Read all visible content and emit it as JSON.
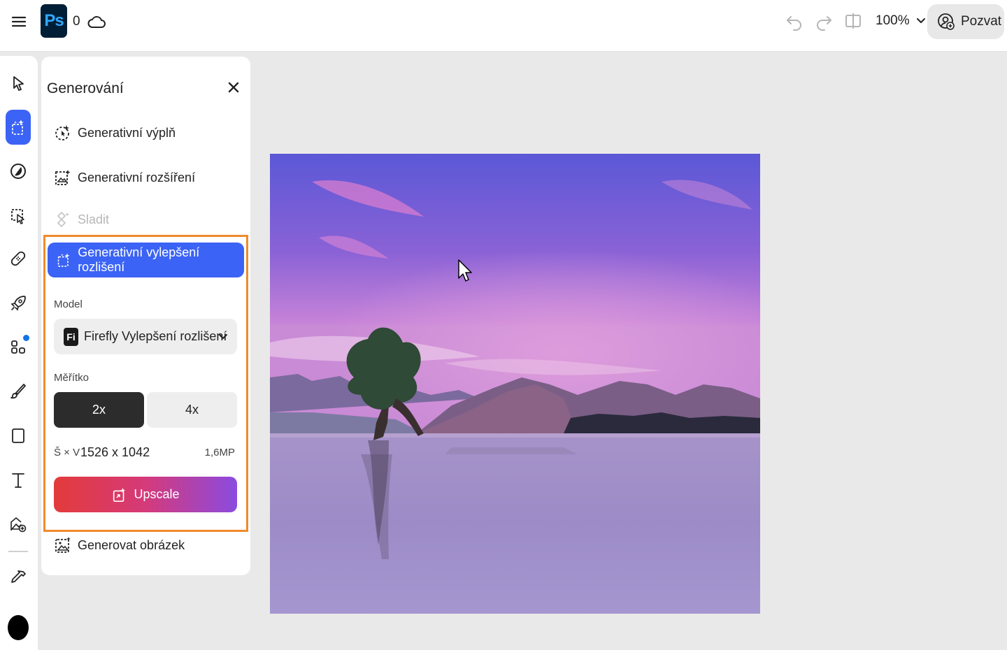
{
  "topbar": {
    "app_logo": "Ps",
    "cloud_count": "0",
    "zoom_label": "100%",
    "invite_label": "Pozvat"
  },
  "panel": {
    "title": "Generování",
    "items": [
      {
        "label": "Generativní výplň",
        "disabled": false
      },
      {
        "label": "Generativní rozšíření",
        "disabled": false
      },
      {
        "label": "Sladit",
        "disabled": true
      }
    ],
    "active_item": "Generativní vylepšení rozlišení",
    "model_label": "Model",
    "model_logo": "Fi",
    "model_value": "Firefly Vylepšení rozlišení",
    "scale_label": "Měřítko",
    "scale_options": [
      "2x",
      "4x"
    ],
    "scale_selected": "2x",
    "dims_label": "Š × V",
    "dims_value": "1526 x 1042",
    "megapixels": "1,6MP",
    "upscale_button": "Upscale",
    "generate_image": "Generovat obrázek"
  },
  "colors": {
    "accent": "#3b63f5",
    "highlight_border": "#f08a2c",
    "upscale_gradient_start": "#e23b3b",
    "upscale_gradient_end": "#8b4be0",
    "ps_logo_bg": "#001e36",
    "ps_logo_fg": "#31a8ff"
  },
  "icons": [
    "menu-icon",
    "cloud-icon",
    "undo-icon",
    "redo-icon",
    "compare-icon",
    "chevron-down-icon",
    "invite-user-icon",
    "select-tool-icon",
    "generative-tool-icon",
    "adjust-icon",
    "crop-select-icon",
    "heal-icon",
    "quick-actions-icon",
    "add-ons-icon",
    "brush-icon",
    "shape-icon",
    "text-icon",
    "add-image-icon",
    "eyedropper-icon",
    "close-icon",
    "generative-fill-icon",
    "generative-expand-icon",
    "harmonize-icon",
    "generative-upscale-icon",
    "generate-image-icon",
    "mouse-cursor-icon"
  ]
}
